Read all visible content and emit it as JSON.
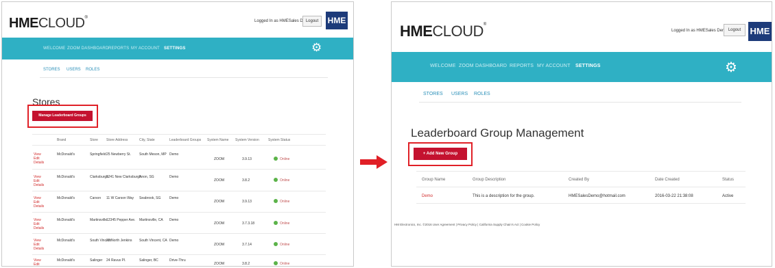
{
  "brand": {
    "bold": "HME",
    "light": "CLOUD",
    "tm": "®",
    "badge": "HME"
  },
  "header": {
    "logged_in": "Logged In as HMESales Demo",
    "logout": "Logout"
  },
  "nav": {
    "items": [
      "WELCOME",
      "ZOOM DASHBOARD",
      "REPORTS",
      "MY ACCOUNT",
      "SETTINGS"
    ],
    "gear_icon": "gear-icon"
  },
  "subnav": {
    "items": [
      "STORES",
      "USERS",
      "ROLES"
    ]
  },
  "left": {
    "title": "Stores",
    "manage_button": "Manage Leaderboard Groups",
    "columns": [
      "Brand",
      "Store",
      "Store Address",
      "City, State",
      "Leaderboard Groups",
      "System Name",
      "System Version",
      "System Status"
    ],
    "rows": [
      {
        "action": "View Edit Details",
        "brand": "McDonald's",
        "store": "Springfield",
        "address": "25 Newberry St.",
        "city": "South Meson, MP",
        "group": "Demo",
        "system": "ZOOM",
        "version": "3.9.13",
        "status": "Online"
      },
      {
        "action": "View Edit Details",
        "brand": "McDonald's",
        "store": "Clarksburgh",
        "address": "1241 New Clarksburgh",
        "city": "Anon, SG",
        "group": "Demo",
        "system": "ZOOM",
        "version": "3.8.2",
        "status": "Online"
      },
      {
        "action": "View Edit Details",
        "brand": "McDonald's",
        "store": "Carson",
        "address": "11 W Carson Way",
        "city": "Seabrook, SG",
        "group": "Demo",
        "system": "ZOOM",
        "version": "3.9.13",
        "status": "Online"
      },
      {
        "action": "View Edit Details",
        "brand": "McDonald's",
        "store": "Martinsville",
        "address": "12345 Pepper Ave.",
        "city": "Martinsville, CA",
        "group": "Demo",
        "system": "ZOOM",
        "version": "3.7.3.18",
        "status": "Online"
      },
      {
        "action": "View Edit Details",
        "brand": "McDonald's",
        "store": "South Vincent",
        "address": "22 North Jenkins",
        "city": "South Vincent, CA",
        "group": "Demo",
        "system": "ZOOM",
        "version": "3.7.14",
        "status": "Online"
      },
      {
        "action": "View Edit Details",
        "brand": "McDonald's",
        "store": "Salinger",
        "address": "24 Ravus Pl.",
        "city": "Salinger, BC",
        "group": "Drive-Thru",
        "system": "ZOOM",
        "version": "3.8.2",
        "status": "Online"
      }
    ]
  },
  "right": {
    "title": "Leaderboard Group Management",
    "add_button": "+ Add New Group",
    "columns": [
      "Group Name",
      "Group Description",
      "Created By",
      "Date Created",
      "Status"
    ],
    "rows": [
      {
        "name": "Demo",
        "description": "This is a description for the group.",
        "created_by": "HMESalesDemo@hotmail.com",
        "date": "2016-03-22 21:38:08",
        "status": "Active"
      }
    ],
    "footer": "HM Electronics, Inc. ©2016 User Agreement | Privacy Policy | California Supply Chain's Act | Cookie Policy"
  },
  "colors": {
    "teal": "#2fb0c4",
    "red": "#c4122f",
    "highlight": "#e01f26",
    "navy": "#1d3b7a"
  }
}
